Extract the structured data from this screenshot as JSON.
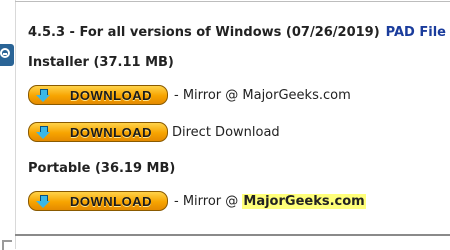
{
  "header": {
    "version_line": "4.5.3 - For all versions of Windows (07/26/2019)",
    "pad_link": "PAD File"
  },
  "installer": {
    "label": "Installer (37.11 MB)",
    "mirror_text_prefix": " - Mirror @ ",
    "mirror_site": "MajorGeeks.com",
    "direct_text": "Direct Download"
  },
  "portable": {
    "label": "Portable (36.19 MB)",
    "mirror_text_prefix": " - Mirror @ ",
    "mirror_site": "MajorGeeks.com"
  },
  "button_label": "DOWNLOAD",
  "colors": {
    "link_blue": "#1a3c9c",
    "button_orange": "#f7a400",
    "highlight_yellow": "#ffff7a",
    "side_button": "#2a6496"
  },
  "icons": {
    "side": "circle-arrow-left-icon",
    "download": "download-arrow-icon"
  }
}
